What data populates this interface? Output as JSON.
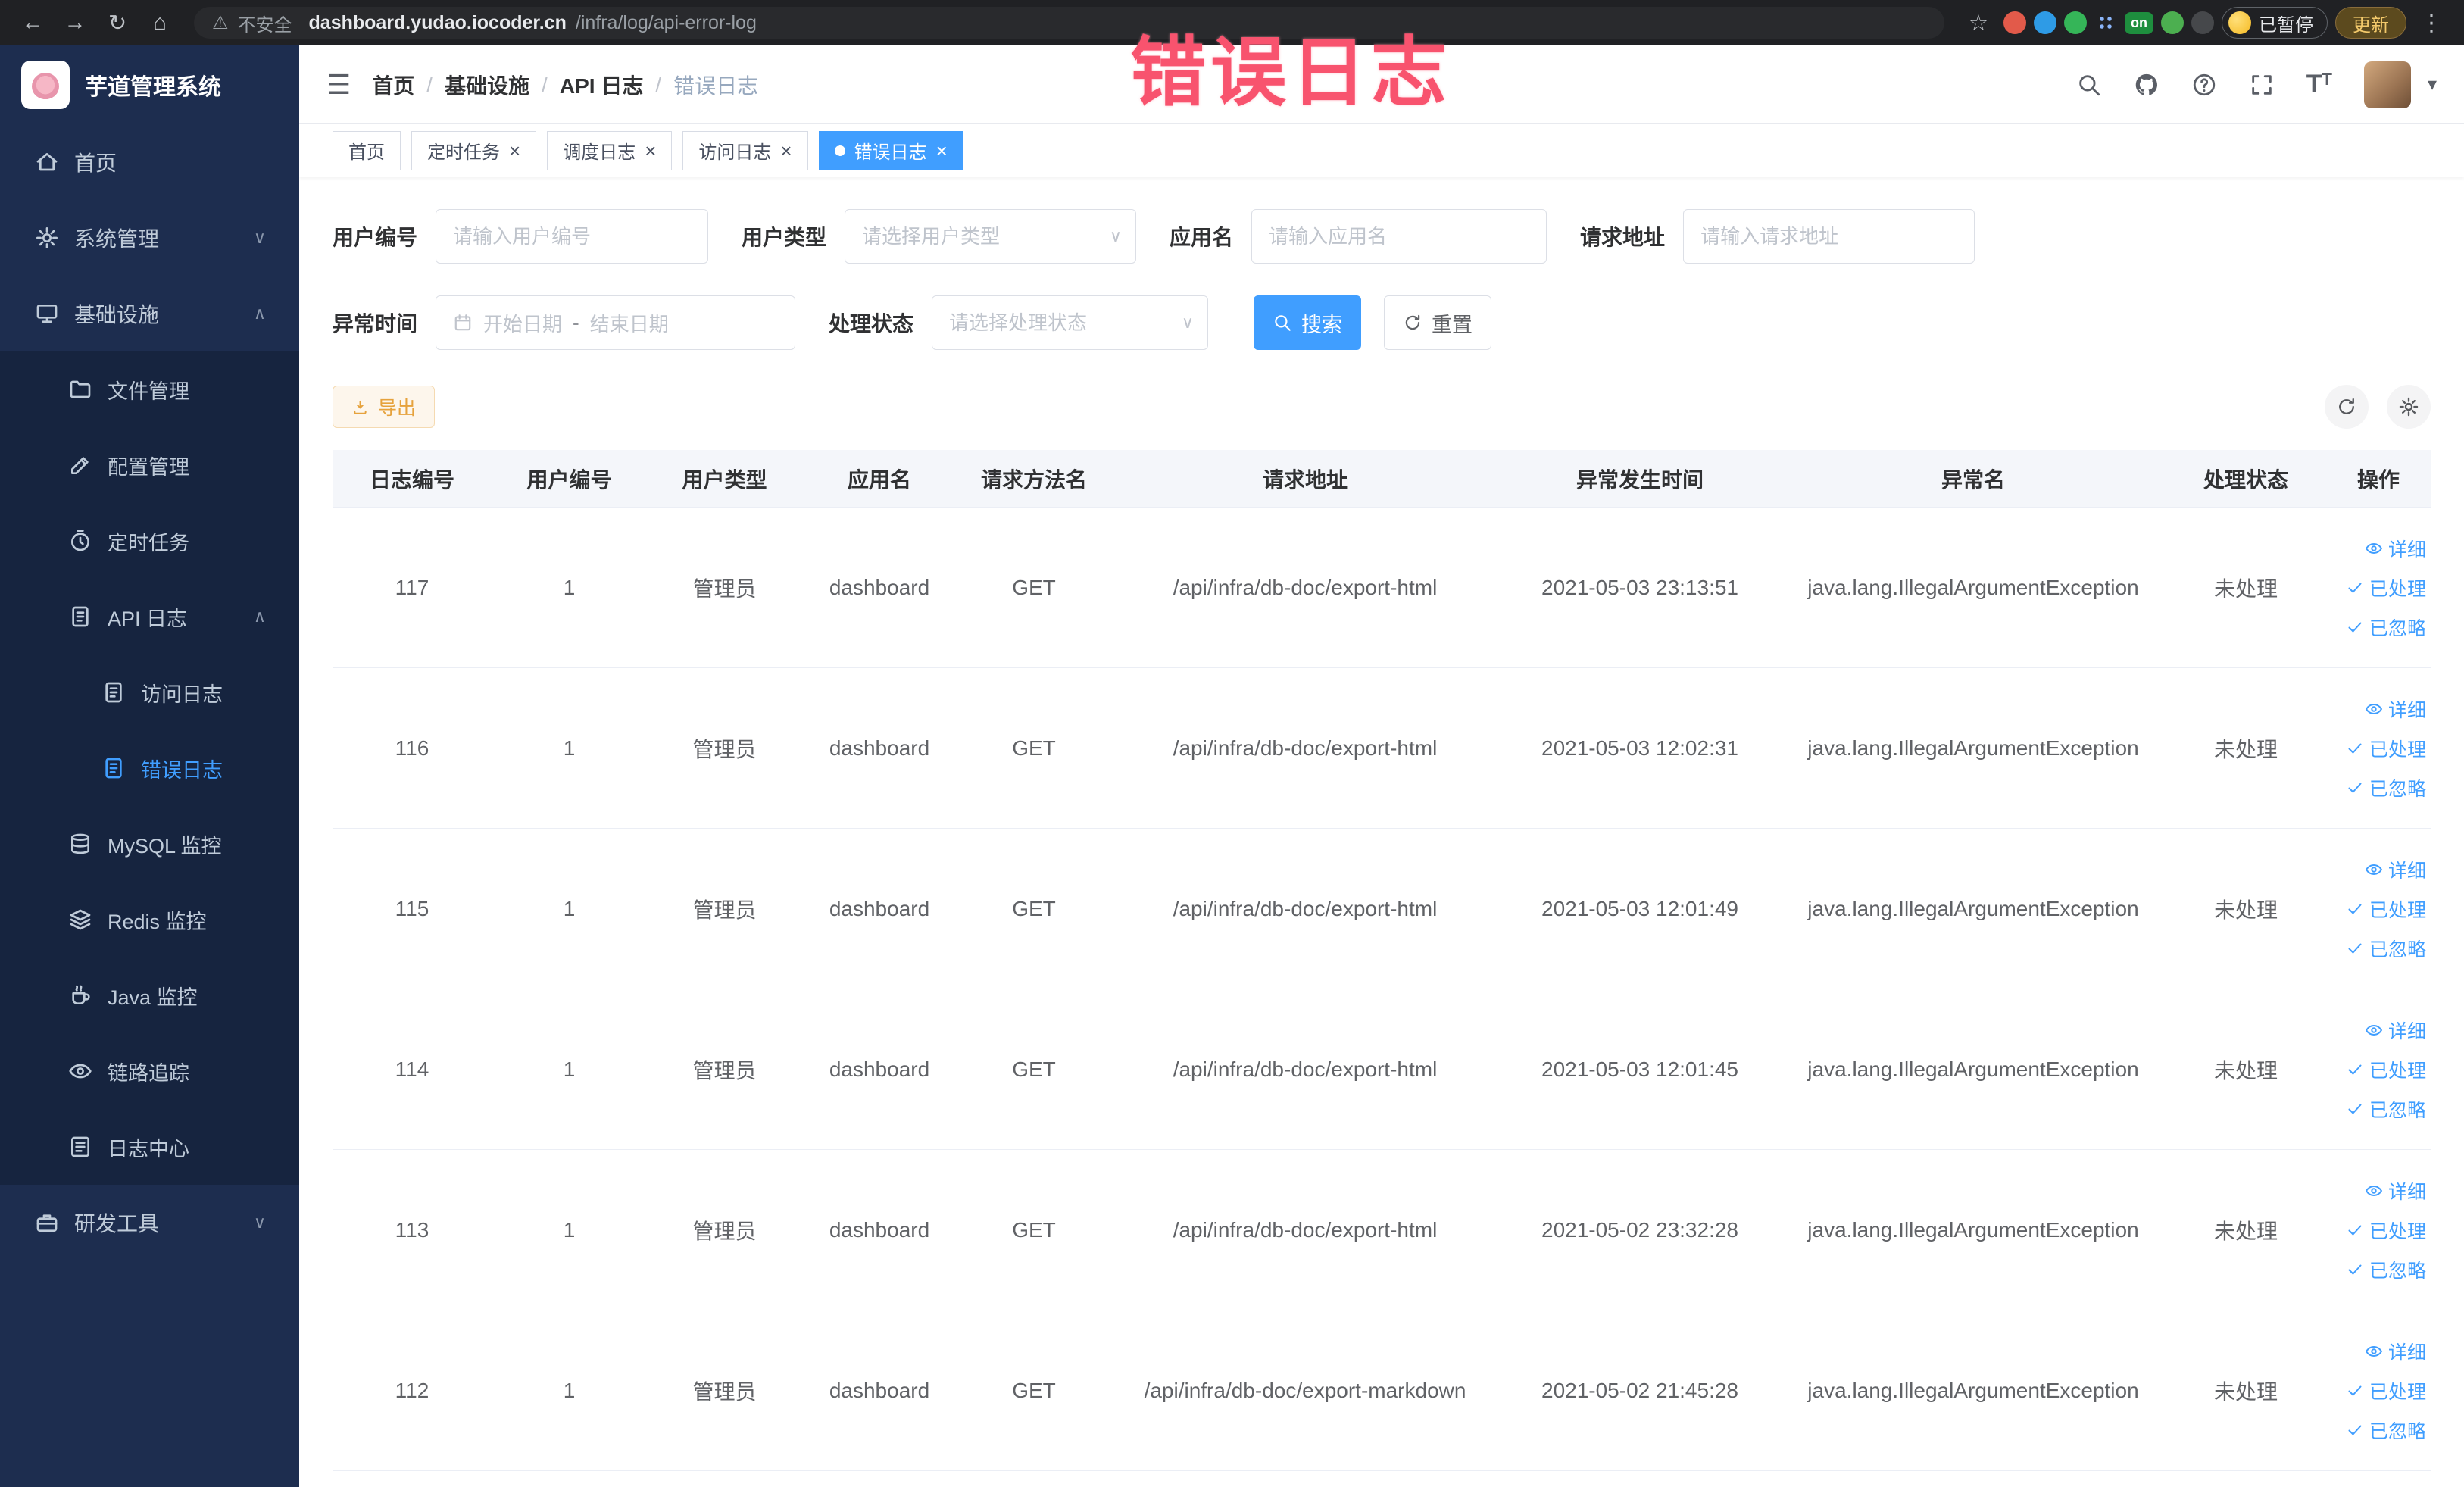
{
  "watermark": "错误日志",
  "browser": {
    "security_label": "不安全",
    "url_host": "dashboard.yudao.iocoder.cn",
    "url_path": "/infra/log/api-error-log",
    "profile_status": "已暂停",
    "update_label": "更新",
    "on_badge": "on"
  },
  "icons": {
    "hamburger": "☰",
    "back": "←",
    "forward": "→",
    "reload": "↻",
    "home": "⌂",
    "warning": "⚠",
    "star": "☆",
    "kebab": "⋮",
    "caret_down": "▾",
    "close": "×",
    "chevron_up": "∧",
    "chevron_down": "∨",
    "date_separator": "-",
    "breadcrumb_separator": "/",
    "font_large": "T",
    "font_small": "T"
  },
  "sidebar": {
    "logo_title": "芋道管理系统",
    "items": [
      {
        "name": "sidebar-item-home",
        "label": "首页",
        "icon": "home-icon",
        "level": 1
      },
      {
        "name": "sidebar-item-system-management",
        "label": "系统管理",
        "icon": "gear-icon",
        "level": 1,
        "arrow": "down"
      },
      {
        "name": "sidebar-item-infrastructure",
        "label": "基础设施",
        "icon": "monitor-icon",
        "level": 1,
        "arrow": "up"
      },
      {
        "name": "sidebar-item-file-management",
        "label": "文件管理",
        "icon": "folder-icon",
        "level": 2,
        "sub": true
      },
      {
        "name": "sidebar-item-config-management",
        "label": "配置管理",
        "icon": "edit-icon",
        "level": 2,
        "sub": true
      },
      {
        "name": "sidebar-item-scheduled-tasks",
        "label": "定时任务",
        "icon": "timer-icon",
        "level": 2,
        "sub": true
      },
      {
        "name": "sidebar-item-api-log",
        "label": "API 日志",
        "icon": "document-icon",
        "level": 2,
        "sub": true,
        "arrow": "up"
      },
      {
        "name": "sidebar-item-access-log",
        "label": "访问日志",
        "icon": "document-icon",
        "level": 3,
        "sub": true
      },
      {
        "name": "sidebar-item-error-log",
        "label": "错误日志",
        "icon": "document-icon",
        "level": 3,
        "sub": true,
        "active": true
      },
      {
        "name": "sidebar-item-mysql-monitor",
        "label": "MySQL 监控",
        "icon": "database-icon",
        "level": 2,
        "sub": true
      },
      {
        "name": "sidebar-item-redis-monitor",
        "label": "Redis 监控",
        "icon": "layers-icon",
        "level": 2,
        "sub": true
      },
      {
        "name": "sidebar-item-java-monitor",
        "label": "Java 监控",
        "icon": "coffee-icon",
        "level": 2,
        "sub": true
      },
      {
        "name": "sidebar-item-link-tracing",
        "label": "链路追踪",
        "icon": "eye-icon",
        "level": 2,
        "sub": true
      },
      {
        "name": "sidebar-item-log-center",
        "label": "日志中心",
        "icon": "log-icon",
        "level": 2,
        "sub": true
      },
      {
        "name": "sidebar-item-dev-tools",
        "label": "研发工具",
        "icon": "toolbox-icon",
        "level": 1,
        "arrow": "down"
      }
    ]
  },
  "breadcrumb": [
    "首页",
    "基础设施",
    "API 日志",
    "错误日志"
  ],
  "tabs": [
    {
      "name": "tab-home",
      "label": "首页",
      "closable": false,
      "active": false
    },
    {
      "name": "tab-scheduled-tasks",
      "label": "定时任务",
      "closable": true,
      "active": false
    },
    {
      "name": "tab-schedule-log",
      "label": "调度日志",
      "closable": true,
      "active": false
    },
    {
      "name": "tab-access-log",
      "label": "访问日志",
      "closable": true,
      "active": false
    },
    {
      "name": "tab-error-log",
      "label": "错误日志",
      "closable": true,
      "active": true
    }
  ],
  "filters": {
    "user_id": {
      "label": "用户编号",
      "placeholder": "请输入用户编号"
    },
    "user_type": {
      "label": "用户类型",
      "placeholder": "请选择用户类型"
    },
    "app_name": {
      "label": "应用名",
      "placeholder": "请输入应用名"
    },
    "request_url": {
      "label": "请求地址",
      "placeholder": "请输入请求地址"
    },
    "exception_time": {
      "label": "异常时间",
      "start_placeholder": "开始日期",
      "end_placeholder": "结束日期"
    },
    "process_status": {
      "label": "处理状态",
      "placeholder": "请选择处理状态"
    },
    "search_label": "搜索",
    "reset_label": "重置"
  },
  "toolbar": {
    "export_label": "导出"
  },
  "table": {
    "columns": [
      "日志编号",
      "用户编号",
      "用户类型",
      "应用名",
      "请求方法名",
      "请求地址",
      "异常发生时间",
      "异常名",
      "处理状态",
      "操作"
    ],
    "row_actions": [
      {
        "name": "detail-link",
        "icon": "eye-icon",
        "label": "详细"
      },
      {
        "name": "mark-processed-link",
        "icon": "check-icon",
        "label": "已处理"
      },
      {
        "name": "mark-ignored-link",
        "icon": "check-icon",
        "label": "已忽略"
      }
    ],
    "rows": [
      {
        "id": "117",
        "user_id": "1",
        "user_type": "管理员",
        "app": "dashboard",
        "method": "GET",
        "url": "/api/infra/db-doc/export-html",
        "time": "2021-05-03 23:13:51",
        "exception": "java.lang.IllegalArgumentException",
        "status": "未处理"
      },
      {
        "id": "116",
        "user_id": "1",
        "user_type": "管理员",
        "app": "dashboard",
        "method": "GET",
        "url": "/api/infra/db-doc/export-html",
        "time": "2021-05-03 12:02:31",
        "exception": "java.lang.IllegalArgumentException",
        "status": "未处理"
      },
      {
        "id": "115",
        "user_id": "1",
        "user_type": "管理员",
        "app": "dashboard",
        "method": "GET",
        "url": "/api/infra/db-doc/export-html",
        "time": "2021-05-03 12:01:49",
        "exception": "java.lang.IllegalArgumentException",
        "status": "未处理"
      },
      {
        "id": "114",
        "user_id": "1",
        "user_type": "管理员",
        "app": "dashboard",
        "method": "GET",
        "url": "/api/infra/db-doc/export-html",
        "time": "2021-05-03 12:01:45",
        "exception": "java.lang.IllegalArgumentException",
        "status": "未处理"
      },
      {
        "id": "113",
        "user_id": "1",
        "user_type": "管理员",
        "app": "dashboard",
        "method": "GET",
        "url": "/api/infra/db-doc/export-html",
        "time": "2021-05-02 23:32:28",
        "exception": "java.lang.IllegalArgumentException",
        "status": "未处理"
      },
      {
        "id": "112",
        "user_id": "1",
        "user_type": "管理员",
        "app": "dashboard",
        "method": "GET",
        "url": "/api/infra/db-doc/export-markdown",
        "time": "2021-05-02 21:45:28",
        "exception": "java.lang.IllegalArgumentException",
        "status": "未处理"
      }
    ]
  }
}
